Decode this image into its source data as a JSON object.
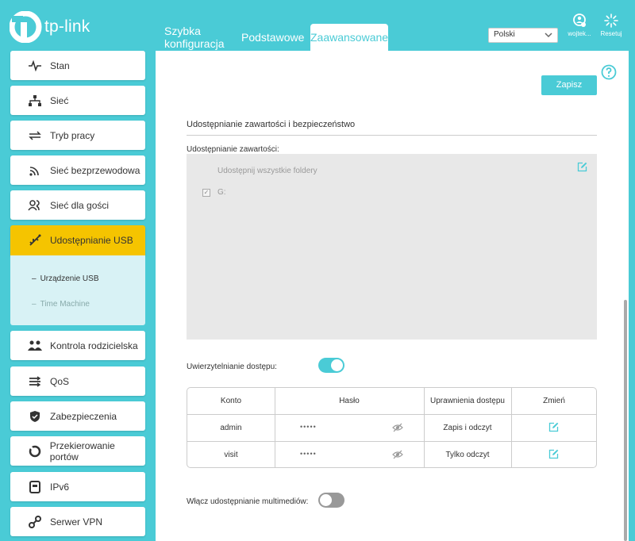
{
  "brand": {
    "name": "tp-link",
    "accent": "#4acbd6",
    "active": "#f5c400"
  },
  "nav": {
    "quick_setup": "Szybka konfiguracja",
    "basic": "Podstawowe",
    "advanced": "Zaawansowane"
  },
  "language": {
    "selected": "Polski"
  },
  "header_actions": {
    "user": "wojtek...",
    "reset": "Resetuj"
  },
  "sidebar": {
    "items": [
      {
        "label": "Stan",
        "icon": "pulse-icon"
      },
      {
        "label": "Sieć",
        "icon": "network-icon"
      },
      {
        "label": "Tryb pracy",
        "icon": "swap-icon"
      },
      {
        "label": "Sieć bezprzewodowa",
        "icon": "wifi-icon"
      },
      {
        "label": "Sieć dla gości",
        "icon": "guests-icon"
      },
      {
        "label": "Udostępnianie USB",
        "icon": "usb-icon"
      },
      {
        "label": "Kontrola rodzicielska",
        "icon": "parental-icon"
      },
      {
        "label": "QoS",
        "icon": "qos-icon"
      },
      {
        "label": "Zabezpieczenia",
        "icon": "shield-icon"
      },
      {
        "label": "Przekierowanie portów",
        "icon": "forward-icon"
      },
      {
        "label": "IPv6",
        "icon": "ipv6-icon"
      },
      {
        "label": "Serwer VPN",
        "icon": "vpn-icon"
      }
    ],
    "sub_items": [
      {
        "label": "Urządzenie USB"
      },
      {
        "label": "Time Machine"
      }
    ]
  },
  "main": {
    "save": "Zapisz",
    "section_title": "Udostępnianie zawartości i bezpieczeństwo",
    "share_label": "Udostępnianie zawartości:",
    "share_all": "Udostępnij wszystkie foldery",
    "drive": "G:",
    "auth_label": "Uwierzytelnianie dostępu:",
    "auth_enabled": true,
    "media_label": "Włącz udostępnianie multimediów:",
    "media_enabled": false,
    "table": {
      "headers": [
        "Konto",
        "Hasło",
        "Uprawnienia dostępu",
        "Zmień"
      ],
      "rows": [
        {
          "account": "admin",
          "password": "•••••",
          "access": "Zapis i odczyt"
        },
        {
          "account": "visit",
          "password": "•••••",
          "access": "Tylko odczyt"
        }
      ]
    }
  }
}
